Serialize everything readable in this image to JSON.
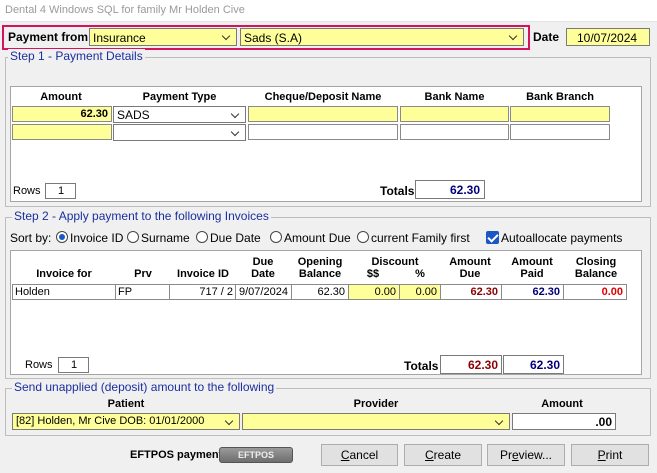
{
  "window": {
    "title": "Dental 4 Windows SQL for family Mr  Holden  Cive"
  },
  "payment_from": {
    "label": "Payment from",
    "source": "Insurance",
    "insurer": "Sads (S.A)",
    "date_label": "Date",
    "date": "10/07/2024"
  },
  "step1": {
    "title": "Step 1 - Payment Details",
    "columns": [
      "Amount",
      "Payment Type",
      "Cheque/Deposit Name",
      "Bank Name",
      "Bank Branch"
    ],
    "row1": {
      "amount": "62.30",
      "payment_type": "SADS"
    },
    "rows_label": "Rows",
    "rows_value": "1",
    "totals_label": "Totals",
    "totals_value": "62.30"
  },
  "step2": {
    "title": "Step 2 - Apply payment to the following Invoices",
    "sort_label": "Sort by:",
    "sort_options": [
      "Invoice ID",
      "Surname",
      "Due Date",
      "Amount Due",
      "current Family first"
    ],
    "autoallocate_label": "Autoallocate payments",
    "headers": {
      "invoice_for": "Invoice for",
      "prv": "Prv",
      "invoice_id": "Invoice ID",
      "due_date_1": "Due",
      "due_date_2": "Date",
      "opening_1": "Opening",
      "opening_2": "Balance",
      "discount": "Discount",
      "discount_amt": "$$",
      "discount_pct": "%",
      "amount_due_1": "Amount",
      "amount_due_2": "Due",
      "amount_paid_1": "Amount",
      "amount_paid_2": "Paid",
      "closing_1": "Closing",
      "closing_2": "Balance"
    },
    "row": {
      "invoice_for": "Holden",
      "prv": "FP",
      "invoice_id": "717 / 2",
      "due_date": "9/07/2024",
      "opening_balance": "62.30",
      "discount_amt": "0.00",
      "discount_pct": "0.00",
      "amount_due": "62.30",
      "amount_paid": "62.30",
      "closing_balance": "0.00"
    },
    "rows_label": "Rows",
    "rows_value": "1",
    "totals_label": "Totals",
    "totals_due": "62.30",
    "totals_paid": "62.30"
  },
  "unapplied": {
    "title": "Send unapplied (deposit) amount to the following",
    "patient_label": "Patient",
    "provider_label": "Provider",
    "amount_label": "Amount",
    "patient_value": "[82] Holden, Mr Cive DOB: 01/01/2000",
    "amount_value": ".00"
  },
  "footer": {
    "eftpos_label": "EFTPOS payment",
    "eftpos_image_text": "EFTPOS",
    "buttons": {
      "cancel_u": "C",
      "cancel_rest": "ancel",
      "create_u": "C",
      "create_rest": "reate",
      "preview_u": "e",
      "preview_pre": "Pr",
      "preview_rest": "view...",
      "print_u": "P",
      "print_rest": "rint"
    }
  }
}
